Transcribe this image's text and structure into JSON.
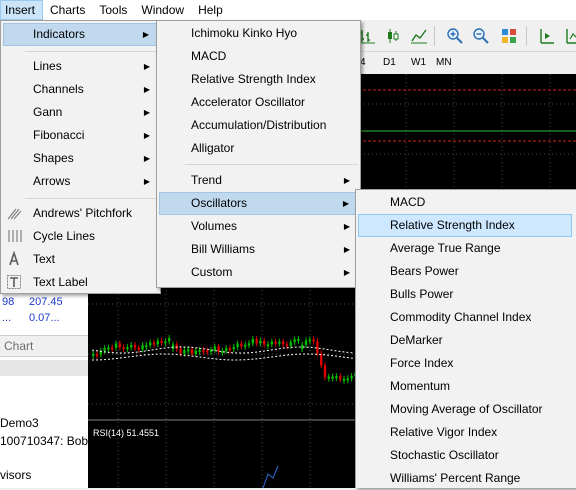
{
  "menubar": {
    "items": [
      "Insert",
      "Charts",
      "Tools",
      "Window",
      "Help"
    ]
  },
  "timeframes": [
    "4",
    "D1",
    "W1",
    "MN"
  ],
  "insert_menu": {
    "items": [
      {
        "label": "Indicators",
        "submenu": true
      },
      {
        "label": "Lines",
        "submenu": true
      },
      {
        "label": "Channels",
        "submenu": true
      },
      {
        "label": "Gann",
        "submenu": true
      },
      {
        "label": "Fibonacci",
        "submenu": true
      },
      {
        "label": "Shapes",
        "submenu": true
      },
      {
        "label": "Arrows",
        "submenu": true
      },
      {
        "label": "Andrews' Pitchfork",
        "icon": "pitchfork-icon"
      },
      {
        "label": "Cycle Lines",
        "icon": "cycle-lines-icon"
      },
      {
        "label": "Text",
        "icon": "text-icon"
      },
      {
        "label": "Text Label",
        "icon": "text-label-icon"
      }
    ]
  },
  "indicators_menu": {
    "items": [
      {
        "label": "Ichimoku Kinko Hyo"
      },
      {
        "label": "MACD"
      },
      {
        "label": "Relative Strength Index"
      },
      {
        "label": "Accelerator Oscillator"
      },
      {
        "label": "Accumulation/Distribution"
      },
      {
        "label": "Alligator"
      },
      {
        "label": "Trend",
        "submenu": true
      },
      {
        "label": "Oscillators",
        "submenu": true
      },
      {
        "label": "Volumes",
        "submenu": true
      },
      {
        "label": "Bill Williams",
        "submenu": true
      },
      {
        "label": "Custom",
        "submenu": true
      }
    ]
  },
  "oscillators_menu": {
    "items": [
      "MACD",
      "Relative Strength Index",
      "Average True Range",
      "Bears Power",
      "Bulls Power",
      "Commodity Channel Index",
      "DeMarker",
      "Force Index",
      "Momentum",
      "Moving Average of Oscillator",
      "Relative Vigor Index",
      "Stochastic Oscillator",
      "Williams' Percent Range"
    ]
  },
  "market_watch": {
    "row1": [
      "98",
      "207.45"
    ],
    "row2": [
      "...",
      "0.07..."
    ],
    "tab": "Chart"
  },
  "navigator": {
    "lines": [
      "Demo3",
      "100710347: Bob",
      "visors"
    ]
  },
  "chart": {
    "rsi_label": "RSI(14) 51.4551"
  },
  "colors": {
    "menu_bg": "#f2f2f2",
    "highlight": "#cde8ff",
    "chart_bg": "#000000",
    "bull_candle": "#00c000",
    "bear_candle": "#e00000"
  }
}
